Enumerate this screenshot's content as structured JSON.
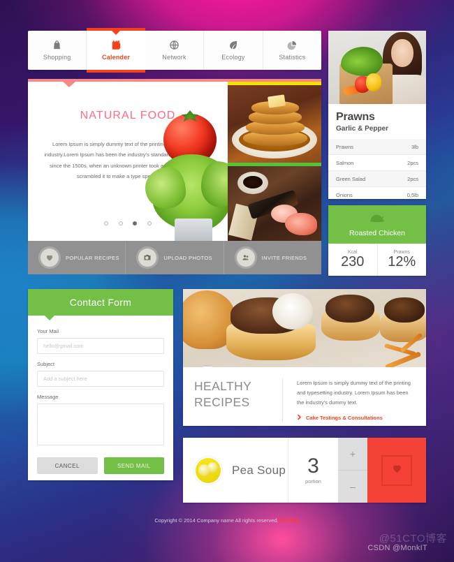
{
  "tabs": [
    {
      "label": "Shopping",
      "icon": "shopping-bag-icon",
      "active": false
    },
    {
      "label": "Calender",
      "icon": "calendar-icon",
      "active": true
    },
    {
      "label": "Network",
      "icon": "globe-icon",
      "active": false
    },
    {
      "label": "Ecology",
      "icon": "leaf-icon",
      "active": false
    },
    {
      "label": "Statistics",
      "icon": "pie-chart-icon",
      "active": false
    }
  ],
  "slider": {
    "title": "NATURAL FOOD",
    "text": "Lorem Ipsum is simply dummy text of the printing and typesetting industry.Lorem Ipsum has been the industry's standard dummy text ever since the 1500s, when an unknown printer took a galley of type and scrambled it to make a type specimen book.",
    "dots": 4,
    "active_dot": 3
  },
  "actions": [
    {
      "label": "POPULAR RECIPES",
      "icon": "heart-icon"
    },
    {
      "label": "UPLOAD PHOTOS",
      "icon": "camera-icon"
    },
    {
      "label": "INVITE FRIENDS",
      "icon": "users-icon"
    }
  ],
  "recipe_card": {
    "title": "Prawns",
    "subtitle": "Garlic & Pepper",
    "ingredients": [
      {
        "name": "Prawns",
        "amount": "3lb"
      },
      {
        "name": "Salmon",
        "amount": "2pcs"
      },
      {
        "name": "Green Salad",
        "amount": "2pcs"
      },
      {
        "name": "Onions",
        "amount": "0,5lb"
      }
    ]
  },
  "stats_card": {
    "title": "Roasted Chicken",
    "icon": "roast-chicken-icon",
    "accent": "#74bf46",
    "stats": [
      {
        "label": "Kcal",
        "value": "230"
      },
      {
        "label": "Prawns",
        "value": "12%"
      }
    ]
  },
  "contact_form": {
    "title": "Contact Form",
    "fields": {
      "mail_label": "Your Mail",
      "mail_placeholder": "hello@gmail.com",
      "mail_value": "",
      "subject_label": "Subject",
      "subject_placeholder": "Add a subject here",
      "subject_value": "",
      "message_label": "Message",
      "message_placeholder": "",
      "message_value": ""
    },
    "cancel_label": "CANCEL",
    "send_label": "SEND MAIL"
  },
  "healthy": {
    "title_line1": "HEALTHY",
    "title_line2": "RECIPES",
    "text": "Lorem Ipsum is simply dummy text of the printing and typesetting industry. Lorem Ipsum has been the industry's dummy text.",
    "link_label": "Cake Testings & Consultations",
    "link_icon": "chevron-right-icon",
    "link_color": "#f4421c"
  },
  "soup": {
    "name": "Pea Soup",
    "icon": "lemon-icon",
    "count": "3",
    "unit": "portion",
    "plus_label": "+",
    "minus_label": "–",
    "fav_icon": "heart-icon",
    "fav_color": "#f44336"
  },
  "footer": {
    "copyright": "Copyright © 2014 Company name All rights reserved.",
    "cn_suffix": "网页模板"
  },
  "watermarks": {
    "primary": "@51CTO博客",
    "secondary": "CSDN @MonkIT"
  }
}
